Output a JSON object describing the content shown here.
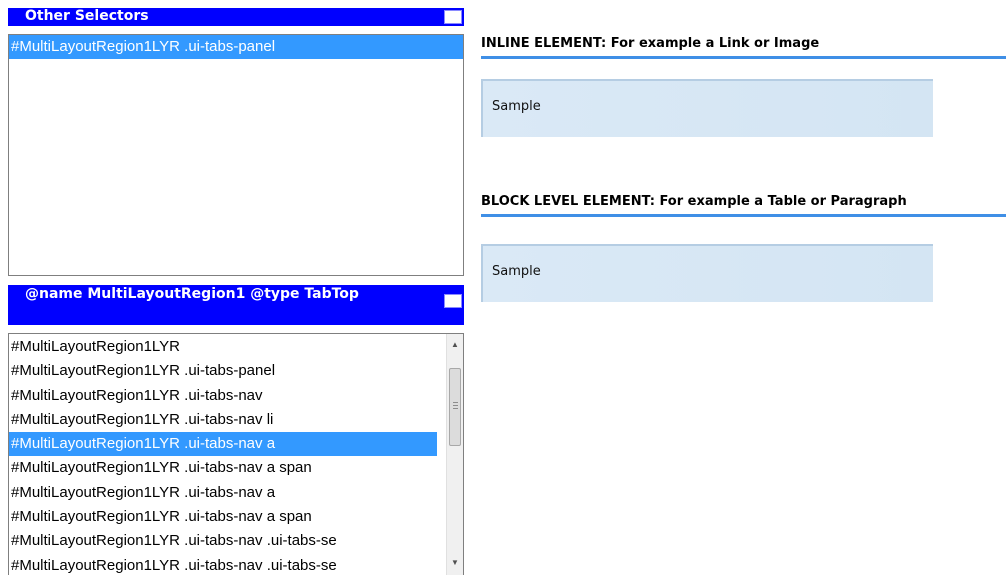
{
  "other_selectors": {
    "title": "Other Selectors",
    "items": [
      {
        "label": "#MultiLayoutRegion1LYR .ui-tabs-panel",
        "selected": true
      }
    ]
  },
  "region_panel": {
    "title": "@name MultiLayoutRegion1 @type TabTop",
    "items": [
      {
        "label": "#MultiLayoutRegion1LYR",
        "selected": false
      },
      {
        "label": "#MultiLayoutRegion1LYR .ui-tabs-panel",
        "selected": false
      },
      {
        "label": "#MultiLayoutRegion1LYR .ui-tabs-nav",
        "selected": false
      },
      {
        "label": "#MultiLayoutRegion1LYR .ui-tabs-nav li",
        "selected": false
      },
      {
        "label": "#MultiLayoutRegion1LYR .ui-tabs-nav a",
        "selected": true
      },
      {
        "label": "#MultiLayoutRegion1LYR .ui-tabs-nav a span",
        "selected": false
      },
      {
        "label": "#MultiLayoutRegion1LYR .ui-tabs-nav a",
        "selected": false
      },
      {
        "label": "#MultiLayoutRegion1LYR .ui-tabs-nav a span",
        "selected": false
      },
      {
        "label": "#MultiLayoutRegion1LYR .ui-tabs-nav .ui-tabs-se",
        "selected": false
      },
      {
        "label": "#MultiLayoutRegion1LYR .ui-tabs-nav .ui-tabs-se",
        "selected": false
      }
    ]
  },
  "inline_section": {
    "title": "INLINE ELEMENT: For example a Link or Image",
    "sample": "Sample"
  },
  "block_section": {
    "title": "BLOCK LEVEL ELEMENT: For example a Table or Paragraph",
    "sample": "Sample"
  },
  "colors": {
    "header_bg": "#0000ff",
    "selection_bg": "#3399ff",
    "title_rule": "#3f8fe6",
    "sample_bg": "#dae9f6"
  },
  "icons": {
    "scroll_up": "▲",
    "scroll_down": "▼"
  }
}
